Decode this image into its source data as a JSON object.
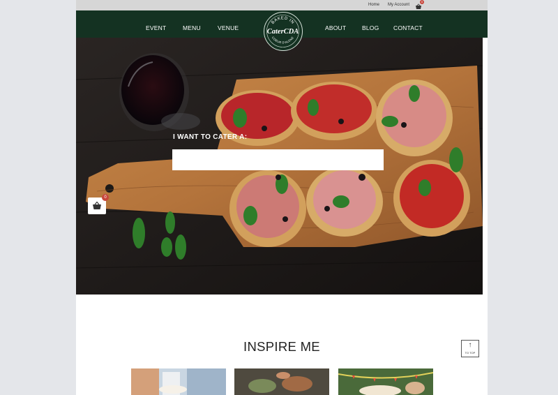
{
  "topbar": {
    "home": "Home",
    "account": "My Account",
    "cart_icon": "basket-icon",
    "cart_count": "0"
  },
  "nav": {
    "left": [
      "EVENT",
      "MENU",
      "VENUE"
    ],
    "right": [
      "ABOUT",
      "BLOG",
      "CONTACT"
    ]
  },
  "logo": {
    "top_text": "BAKED IN",
    "brand": "CaterCDA",
    "bottom_text": "COEUR D'ALENE"
  },
  "hero": {
    "title": "I WANT TO CATER A:",
    "input_value": ""
  },
  "side_cart": {
    "icon": "basket-icon",
    "count": "0"
  },
  "inspire": {
    "heading": "INSPIRE ME"
  },
  "to_top": {
    "label": "TO TOP",
    "icon": "arrow-up-icon"
  },
  "colors": {
    "nav_bg": "#143222",
    "badge": "#c8463b",
    "topbar_bg": "#d6d6d6"
  }
}
